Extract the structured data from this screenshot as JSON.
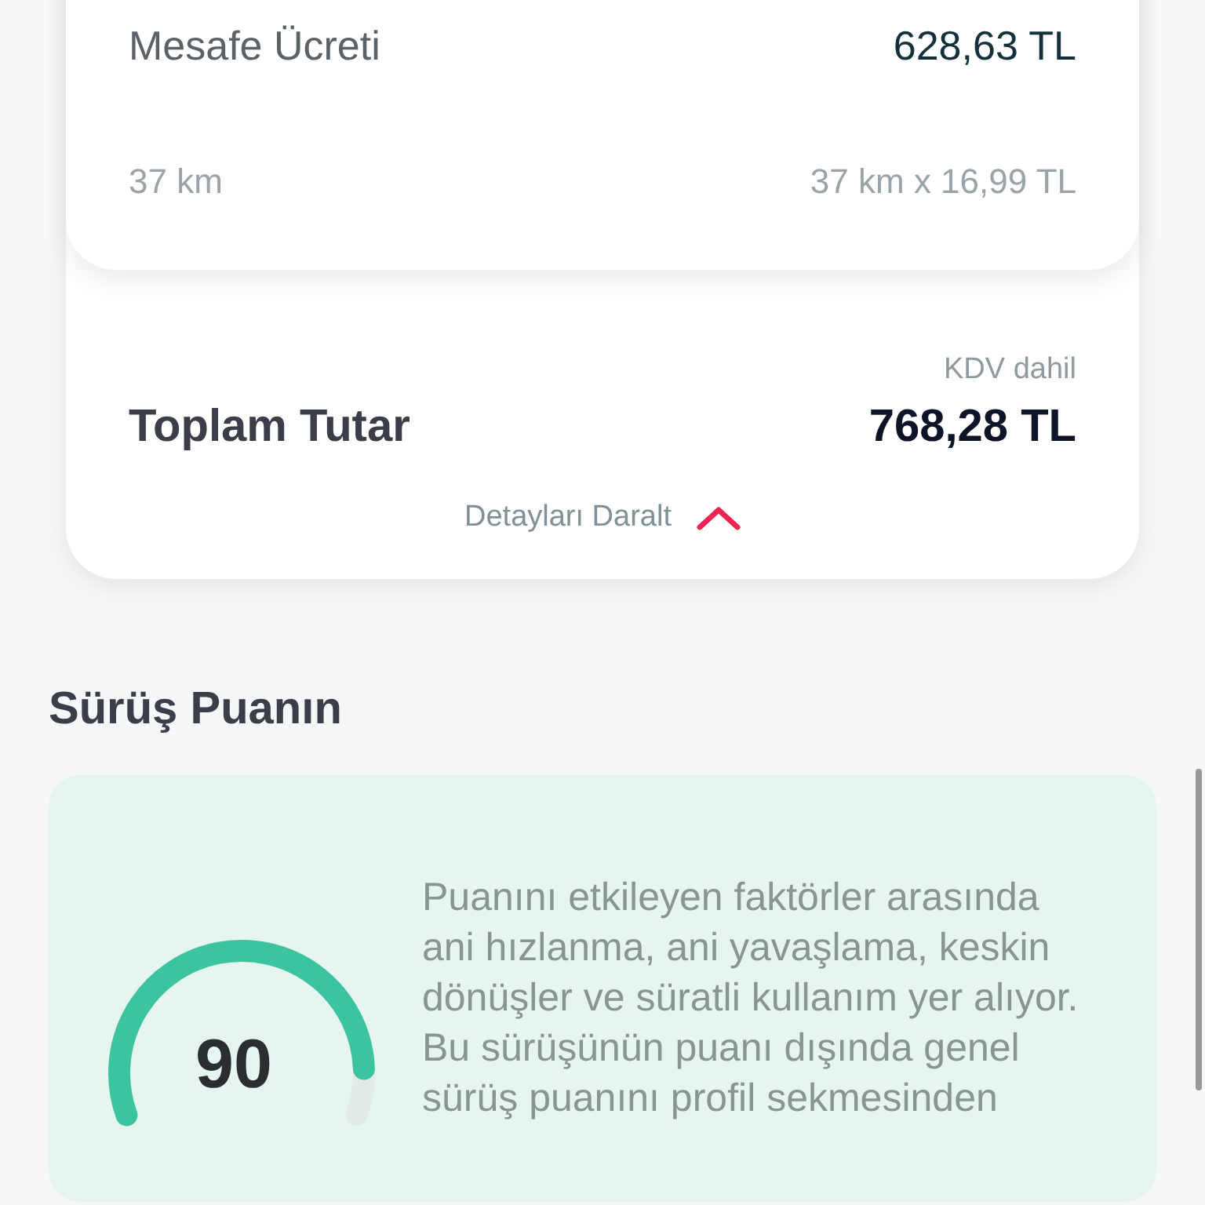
{
  "fare_card": {
    "label": "Mesafe Ücreti",
    "amount": "628,63 TL",
    "distance": "37 km",
    "calculation": "37 km x 16,99 TL"
  },
  "total": {
    "tax_note": "KDV dahil",
    "label": "Toplam Tutar",
    "amount": "768,28 TL",
    "toggle": {
      "label": "Detayları Daralt",
      "expanded": true
    }
  },
  "score_section": {
    "title": "Sürüş Puanın",
    "score": "90",
    "description": "Puanını etkileyen faktörler arasında ani hızlanma, ani yavaşlama, keskin dönüşler ve süratli kullanım yer alıyor. Bu sürüşünün puanı dışında genel sürüş puanını profil sekmesinden"
  }
}
